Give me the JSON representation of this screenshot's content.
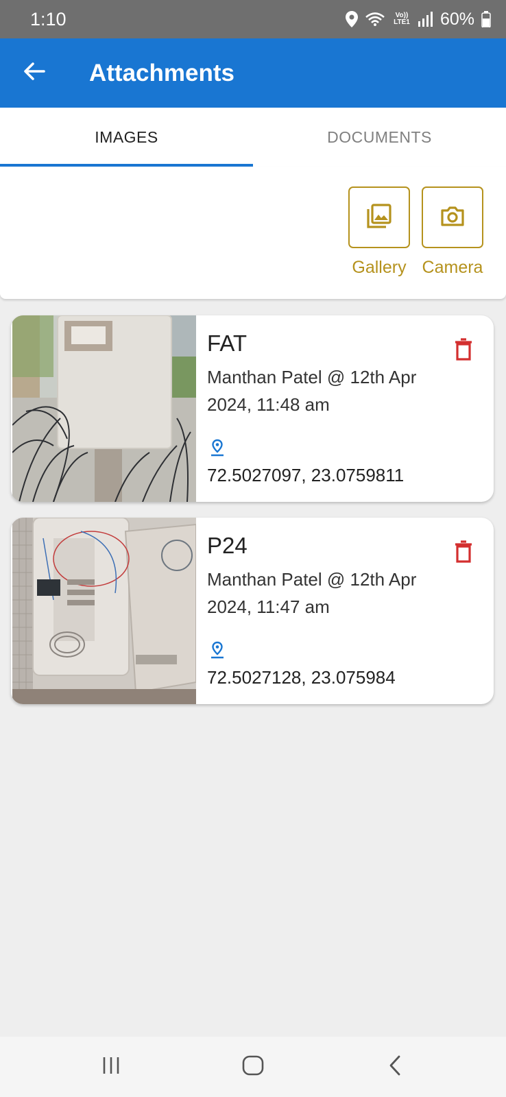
{
  "status_bar": {
    "time": "1:10",
    "network_label": "Vo)) LTE1",
    "battery": "60%",
    "icons": [
      "location-icon",
      "wifi-icon",
      "volte-icon",
      "signal-icon",
      "battery-icon"
    ]
  },
  "app_bar": {
    "title": "Attachments",
    "background": "#1976d2"
  },
  "tabs": [
    {
      "label": "IMAGES",
      "active": true
    },
    {
      "label": "DOCUMENTS",
      "active": false
    }
  ],
  "actions": {
    "gallery_label": "Gallery",
    "camera_label": "Camera",
    "accent": "#b5921d"
  },
  "attachments": [
    {
      "title": "FAT",
      "uploaded_by": "Manthan Patel @ 12th Apr 2024, 11:48 am",
      "coordinates": "72.5027097, 23.0759811"
    },
    {
      "title": "P24",
      "uploaded_by": "Manthan Patel @ 12th Apr 2024, 11:47 am",
      "coordinates": "72.5027128, 23.075984"
    }
  ],
  "colors": {
    "delete": "#d32f2f",
    "pin": "#1976d2"
  },
  "nav_bar": {
    "icons": [
      "recent-apps-icon",
      "home-icon",
      "back-nav-icon"
    ]
  }
}
